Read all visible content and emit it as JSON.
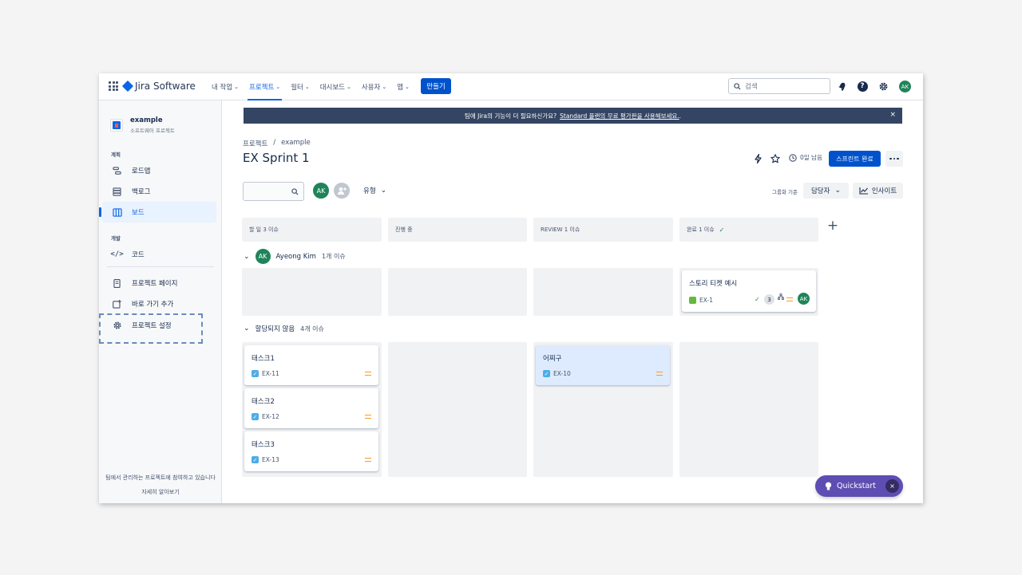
{
  "topnav": {
    "logo_text": "Jira Software",
    "items": [
      {
        "label": "내 작업",
        "active": false
      },
      {
        "label": "프로젝트",
        "active": true
      },
      {
        "label": "필터",
        "active": false
      },
      {
        "label": "대시보드",
        "active": false
      },
      {
        "label": "사용자",
        "active": false
      },
      {
        "label": "앱",
        "active": false
      }
    ],
    "create_label": "만들기",
    "search_placeholder": "검색",
    "avatar_initials": "AK"
  },
  "sidebar": {
    "project_name": "example",
    "project_type": "소프트웨어 프로젝트",
    "planning_label": "계획",
    "dev_label": "개발",
    "items": {
      "roadmap": "로드맵",
      "backlog": "백로그",
      "board": "보드",
      "code": "코드",
      "project_pages": "프로젝트 페이지",
      "add_shortcut": "바로 가기 추가",
      "project_settings": "프로젝트 설정"
    },
    "footer_text": "팀에서 관리하는 프로젝트에 참여하고 있습니다",
    "footer_link": "자세히 알아보기"
  },
  "banner": {
    "text": "팀에 Jira의 기능이 더 필요하신가요?",
    "link": "Standard 플랜의 무료 평가판을 사용해보세요.",
    "tail": ".",
    "close": "×"
  },
  "header": {
    "breadcrumb_root": "프로젝트",
    "breadcrumb_sep": "/",
    "breadcrumb_project": "example",
    "title": "EX Sprint 1",
    "days_left": "0일 남음",
    "complete_label": "스프린트 완료"
  },
  "toolbar": {
    "avatar_initials": "AK",
    "type_label": "유형",
    "groupby_label": "그룹화 기준",
    "groupby_value": "담당자",
    "insights_label": "인사이트"
  },
  "columns": [
    {
      "label": "할 일 3 이슈"
    },
    {
      "label": "진행 중"
    },
    {
      "label": "REVIEW 1 이슈"
    },
    {
      "label": "완료 1 이슈"
    }
  ],
  "swimlanes": [
    {
      "avatar": "AK",
      "name": "Ayeong Kim",
      "count": "1개 이슈",
      "cards": [
        {
          "title": "스토리 티켓 예시",
          "key": "EX-1",
          "subtasks": "3",
          "assignee": "AK"
        }
      ]
    },
    {
      "name": "할당되지 않음",
      "count": "4개 이슈",
      "cards": [
        {
          "title": "태스크1",
          "key": "EX-11"
        },
        {
          "title": "태스크2",
          "key": "EX-12"
        },
        {
          "title": "태스크3",
          "key": "EX-13"
        },
        {
          "title": "어찌구",
          "key": "EX-10"
        }
      ]
    }
  ],
  "quickstart": {
    "label": "Quickstart",
    "close": "×"
  },
  "colors": {
    "brand": "#0052cc",
    "avatar": "#1f845a",
    "quickstart": "#5e4db2",
    "priority": "#ff991f"
  }
}
